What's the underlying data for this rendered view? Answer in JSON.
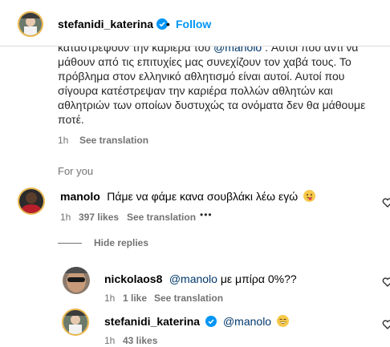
{
  "header": {
    "username": "stefanidi_katerina",
    "separator": "•",
    "follow_label": "Follow"
  },
  "caption": {
    "text": "καταστρέψουν την καριέρα του @manolo . Αυτοί που αντί να μάθουν από τις επιτυχίες μας συνεχίζουν τον χαβά τους. Το πρόβλημα στον ελληνικό αθλητισμό είναι αυτοί. Αυτοί που σίγουρα κατέστρεψαν την καριέρα πολλών αθλητών και αθλητριών των οποίων δυστυχώς τα ονόματα δεν θα μάθουμε ποτέ.",
    "time": "1h",
    "see_translation": "See translation"
  },
  "for_you": "For you",
  "comments": [
    {
      "username": "manolo",
      "text": "Πάμε να φάμε κανα σουβλάκι λέω εγώ",
      "emoji": "stuck-out-tongue",
      "time": "1h",
      "likes": "397 likes",
      "see_translation": "See translation",
      "more": "•••"
    }
  ],
  "hide_replies": "Hide replies",
  "replies": [
    {
      "username": "nickolaos8",
      "mention": "@manolo",
      "text": " με μπίρα 0%??",
      "time": "1h",
      "likes": "1 like",
      "see_translation": "See translation"
    },
    {
      "username": "stefanidi_katerina",
      "mention": "@manolo",
      "emoji": "grinning",
      "time": "1h",
      "likes": "43 likes"
    }
  ],
  "colors": {
    "link": "#0095f6",
    "mention": "#00376b",
    "secondary": "#737373",
    "verified": "#0095f6"
  }
}
